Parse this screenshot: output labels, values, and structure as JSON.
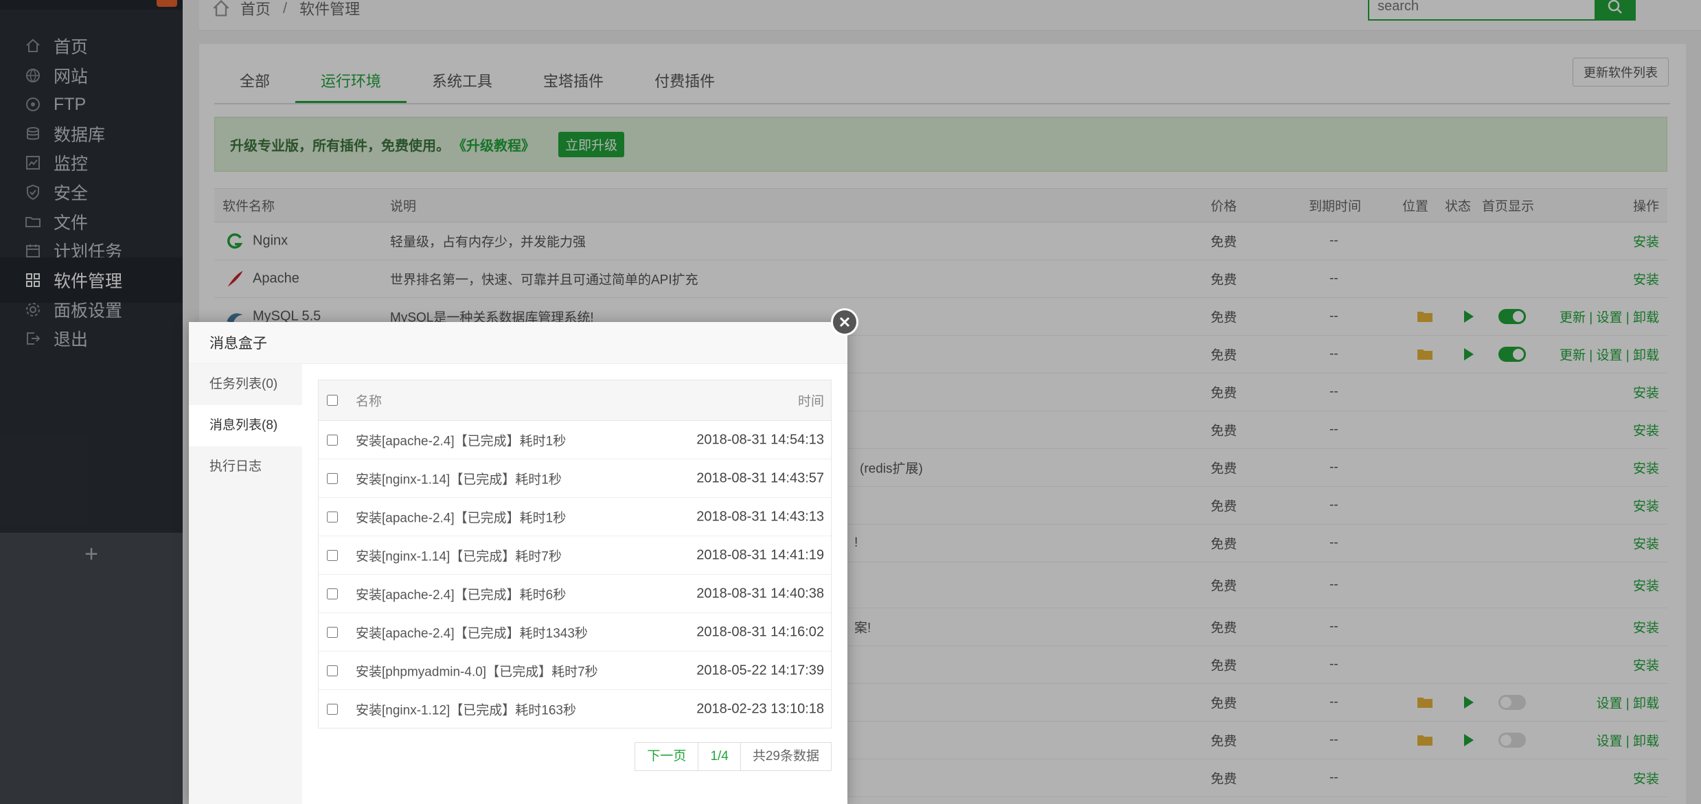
{
  "sidebar": {
    "brand": "",
    "items": [
      {
        "label": "首页",
        "icon": "home-icon"
      },
      {
        "label": "网站",
        "icon": "globe-icon"
      },
      {
        "label": "FTP",
        "icon": "ftp-icon"
      },
      {
        "label": "数据库",
        "icon": "database-icon"
      },
      {
        "label": "监控",
        "icon": "monitor-icon"
      },
      {
        "label": "安全",
        "icon": "shield-icon"
      },
      {
        "label": "文件",
        "icon": "folder-icon"
      },
      {
        "label": "计划任务",
        "icon": "calendar-icon"
      },
      {
        "label": "软件管理",
        "icon": "grid-icon",
        "active": true
      },
      {
        "label": "面板设置",
        "icon": "gear-icon"
      },
      {
        "label": "退出",
        "icon": "logout-icon"
      }
    ],
    "add_label": "+"
  },
  "header": {
    "crumb_home": "首页",
    "crumb_sep": "/",
    "crumb_current": "软件管理",
    "search_placeholder": "search"
  },
  "tabs": [
    "全部",
    "运行环境",
    "系统工具",
    "宝塔插件",
    "付费插件"
  ],
  "update_button": "更新软件列表",
  "promo": {
    "text": "升级专业版，所有插件，免费使用。",
    "link": "《升级教程》",
    "button": "立即升级"
  },
  "table": {
    "headers": {
      "name": "软件名称",
      "desc": "说明",
      "price": "价格",
      "expire": "到期时间",
      "position": "位置",
      "status": "状态",
      "home": "首页显示",
      "ops": "操作"
    },
    "rows": [
      {
        "name": "Nginx",
        "desc": "轻量级，占有内存少，并发能力强",
        "price": "免费",
        "expire": "--",
        "ops": "安装"
      },
      {
        "name": "Apache",
        "desc": "世界排名第一，快速、可靠并且可通过简单的API扩充",
        "price": "免费",
        "expire": "--",
        "ops": "安装"
      },
      {
        "name": "MySQL 5.5",
        "desc": "MySQL是一种关系数据库管理系统!",
        "price": "免费",
        "expire": "--",
        "ops": "更新 | 设置 | 卸载"
      },
      {
        "name": "",
        "desc": "",
        "price": "免费",
        "expire": "--",
        "ops": "更新 | 设置 | 卸载"
      },
      {
        "name": "",
        "desc": "",
        "price": "免费",
        "expire": "--",
        "ops": "安装"
      },
      {
        "name": "",
        "desc": "",
        "price": "免费",
        "expire": "--",
        "ops": "安装"
      },
      {
        "name": "",
        "desc": "(redis扩展)",
        "price": "免费",
        "expire": "--",
        "ops": "安装"
      },
      {
        "name": "",
        "desc": "",
        "price": "免费",
        "expire": "--",
        "ops": "安装"
      },
      {
        "name": "",
        "desc": "!",
        "price": "免费",
        "expire": "--",
        "ops": "安装"
      },
      {
        "name": "",
        "desc": "",
        "price": "免费",
        "expire": "--",
        "ops": "安装"
      },
      {
        "name": "",
        "desc": "案!",
        "price": "免费",
        "expire": "--",
        "ops": "安装"
      },
      {
        "name": "",
        "desc": "",
        "price": "免费",
        "expire": "--",
        "ops": "安装"
      },
      {
        "name": "",
        "desc": "",
        "price": "免费",
        "expire": "--",
        "ops": "设置 | 卸载"
      },
      {
        "name": "",
        "desc": "",
        "price": "免费",
        "expire": "--",
        "ops": "设置 | 卸载"
      },
      {
        "name": "",
        "desc": "",
        "price": "免费",
        "expire": "--",
        "ops": "安装"
      }
    ]
  },
  "modal": {
    "title": "消息盒子",
    "side": [
      "任务列表(0)",
      "消息列表(8)",
      "执行日志"
    ],
    "head_name": "名称",
    "head_time": "时间",
    "messages": [
      {
        "name": "安装[apache-2.4]【已完成】耗时1秒",
        "time": "2018-08-31 14:54:13"
      },
      {
        "name": "安装[nginx-1.14]【已完成】耗时1秒",
        "time": "2018-08-31 14:43:57"
      },
      {
        "name": "安装[apache-2.4]【已完成】耗时1秒",
        "time": "2018-08-31 14:43:13"
      },
      {
        "name": "安装[nginx-1.14]【已完成】耗时7秒",
        "time": "2018-08-31 14:41:19"
      },
      {
        "name": "安装[apache-2.4]【已完成】耗时6秒",
        "time": "2018-08-31 14:40:38"
      },
      {
        "name": "安装[apache-2.4]【已完成】耗时1343秒",
        "time": "2018-08-31 14:16:02"
      },
      {
        "name": "安装[phpmyadmin-4.0]【已完成】耗时7秒",
        "time": "2018-05-22 14:17:39"
      },
      {
        "name": "安装[nginx-1.12]【已完成】耗时163秒",
        "time": "2018-02-23 13:10:18"
      }
    ],
    "pager": {
      "next": "下一页",
      "page": "1/4",
      "total": "共29条数据"
    }
  },
  "colors": {
    "accent": "#20a53a",
    "sidebar": "#2c3138"
  }
}
